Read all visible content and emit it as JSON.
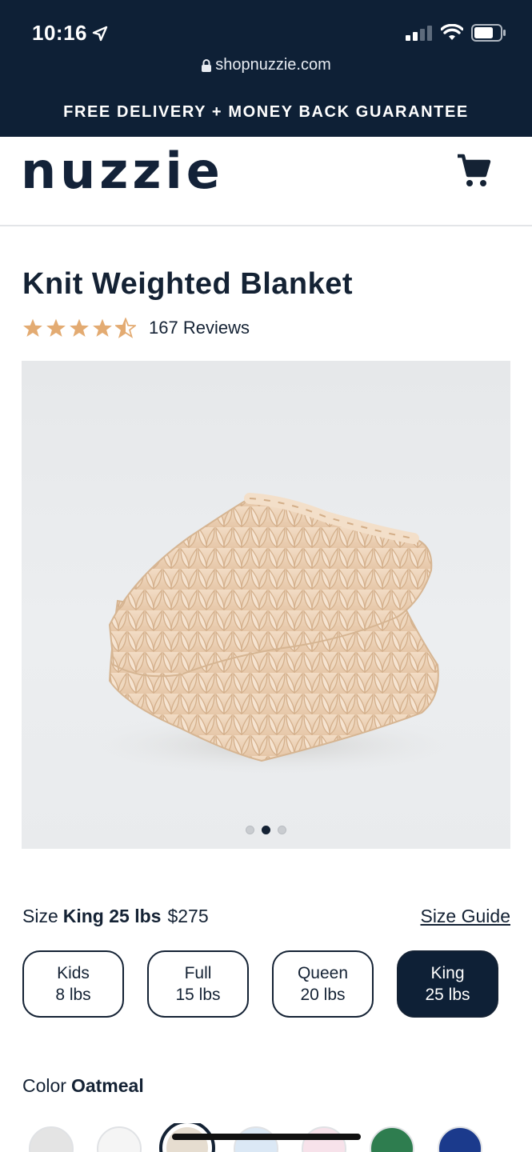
{
  "status": {
    "time": "10:16",
    "url": "shopnuzzie.com"
  },
  "promo": {
    "text": "FREE DELIVERY + MONEY BACK GUARANTEE"
  },
  "header": {
    "logo": "nuzzie"
  },
  "product": {
    "title": "Knit Weighted Blanket",
    "rating": 4.5,
    "reviews": "167 Reviews",
    "image_count": 3,
    "active_image": 2
  },
  "size": {
    "label": "Size",
    "selected": "King 25 lbs",
    "price": "$275",
    "guide": "Size Guide",
    "options": [
      {
        "name": "Kids",
        "weight": "8 lbs"
      },
      {
        "name": "Full",
        "weight": "15 lbs"
      },
      {
        "name": "Queen",
        "weight": "20 lbs"
      },
      {
        "name": "King",
        "weight": "25 lbs"
      }
    ]
  },
  "color": {
    "label": "Color",
    "selected": "Oatmeal",
    "swatches": [
      "#e4e4e4",
      "#f5f5f5",
      "#e6ddd0",
      "#dbe8f5",
      "#f7e2ea",
      "#2e7d4f",
      "#1b3a8c"
    ]
  },
  "colors": {
    "navy": "#0e2036",
    "star": "#e3ab72"
  }
}
